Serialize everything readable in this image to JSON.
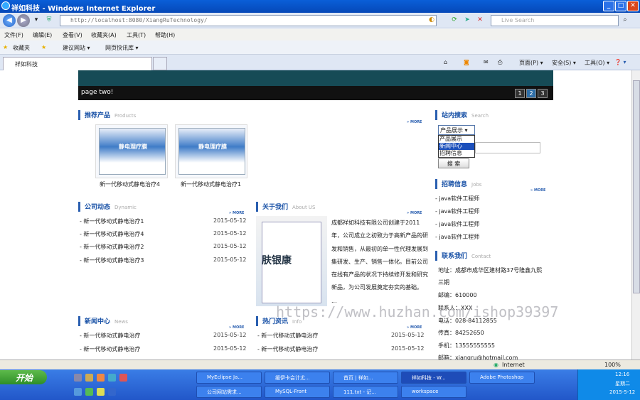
{
  "window": {
    "title": "祥如科技 - Windows Internet Explorer",
    "min": "_",
    "max": "□",
    "close": "✕"
  },
  "address": {
    "url": "http://localhost:8080/XiangRuTechnology/",
    "search_placeholder": "Live Search"
  },
  "menu": [
    "文件(F)",
    "编辑(E)",
    "查看(V)",
    "收藏夹(A)",
    "工具(T)",
    "帮助(H)"
  ],
  "favorites": {
    "label": "收藏夹",
    "items": [
      "建议网站 ▾",
      "网页快讯库 ▾"
    ]
  },
  "tab": {
    "label": "祥如科技"
  },
  "toolbar": {
    "page": "页面(P) ▾",
    "safety": "安全(S) ▾",
    "tools": "工具(O) ▾",
    "help": "❓ ▾"
  },
  "page": {
    "slider": {
      "caption": "page two!",
      "pages": [
        "1",
        "2",
        "3"
      ]
    },
    "products": {
      "title": "推荐产品",
      "en": "Products",
      "more": "MORE",
      "items": [
        {
          "name": "新一代移动式静电治疗4",
          "box": "静电理疗膜"
        },
        {
          "name": "新一代移动式静电治疗1",
          "box": "静电理疗膜"
        }
      ]
    },
    "dynamic": {
      "title": "公司动态",
      "en": "Dynamic",
      "more": "MORE",
      "items": [
        {
          "t": "- 新一代移动式静电治疗1",
          "d": "2015-05-12"
        },
        {
          "t": "- 新一代移动式静电治疗4",
          "d": "2015-05-12"
        },
        {
          "t": "- 新一代移动式静电治疗2",
          "d": "2015-05-12"
        },
        {
          "t": "- 新一代移动式静电治疗3",
          "d": "2015-05-12"
        }
      ]
    },
    "about": {
      "title": "关于我们",
      "en": "About US",
      "more": "MORE",
      "image_text": "肤银康",
      "text": "成都祥如科技有限公司创建于2011年，公司成立之初致力于高新产品的研发和销售，从最初的单一性代理发展到集研发、生产、销售一体化。目前公司在线有产品的状况下持续修开发和研究新品，为公司发展奠定夯实的基础。 ..."
    },
    "news": {
      "title": "新闻中心",
      "en": "News",
      "more": "MORE",
      "items": [
        {
          "t": "- 新一代移动式静电治疗",
          "d": "2015-05-12"
        },
        {
          "t": "- 新一代移动式静电治疗",
          "d": "2015-05-12"
        }
      ]
    },
    "hot": {
      "title": "热门资讯",
      "en": "Info",
      "more": "MORE",
      "items": [
        {
          "t": "- 新一代移动式静电治疗",
          "d": "2015-05-12"
        },
        {
          "t": "- 新一代移动式静电治疗",
          "d": "2015-05-12"
        }
      ]
    },
    "search": {
      "title": "站内搜索",
      "en": "Search",
      "selected": "产品展示",
      "options": [
        "产品展示",
        "新闻中心",
        "招聘信息"
      ],
      "button": "搜 索"
    },
    "jobs": {
      "title": "招聘信息",
      "en": "Jobs",
      "more": "MORE",
      "items": [
        "- java软件工程师",
        "- java软件工程师",
        "- java软件工程师",
        "- java软件工程师"
      ]
    },
    "contact": {
      "title": "联系我们",
      "en": "Contact",
      "lines": [
        "地址：成都市成华区建材路37号隆鑫九熙",
        "三期",
        "邮编：610000",
        "联系人：XXX",
        "电话：028-84112855",
        "传真：84252650",
        "手机：13555555555",
        "邮箱：xiangru@hotmail.com"
      ]
    },
    "watermark": "https://www.huzhan.com/ishop39397"
  },
  "status": {
    "zone": "Internet",
    "zoom": "100%"
  },
  "taskbar": {
    "start": "开始",
    "windows": [
      "MyEclipse Ja...",
      "缓伊卡会计尤...",
      "首页 | 祥如...",
      "祥如科技 - W...",
      "Adobe Photoshop",
      "公司网站需求...",
      "MySQL-Front",
      "111.txt - 记...",
      "workspace"
    ],
    "time": "12:16",
    "weekday": "星期二",
    "date": "2015-5-12"
  }
}
